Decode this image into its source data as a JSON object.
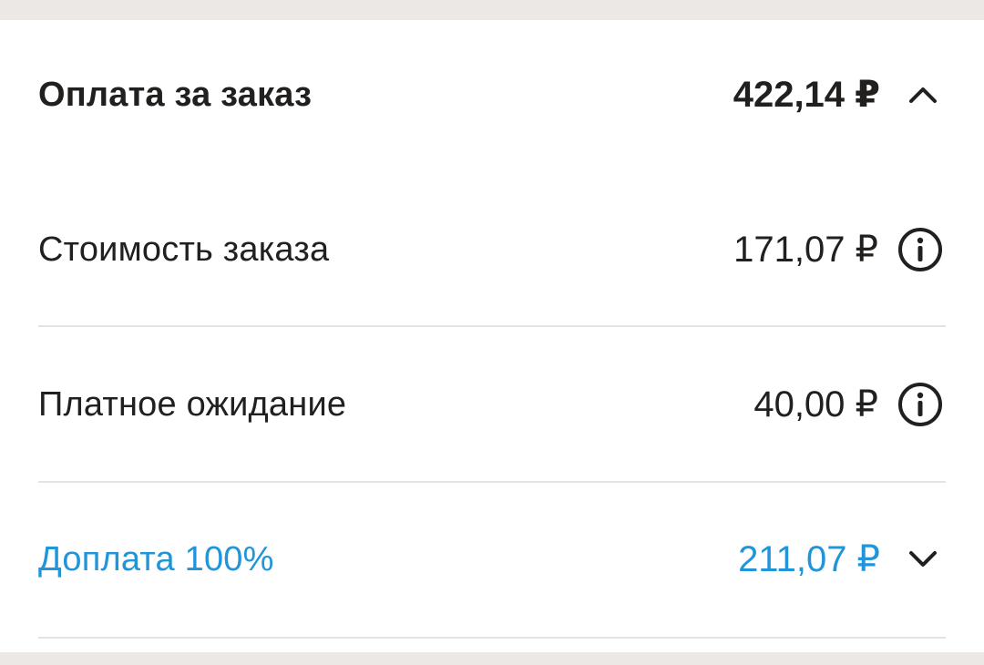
{
  "payment": {
    "title": "Оплата за заказ",
    "total": "422,14 ₽",
    "expand_icon": "chevron-up-icon"
  },
  "lines": [
    {
      "label": "Стоимость заказа",
      "amount": "171,07 ₽",
      "icon": "info-icon"
    },
    {
      "label": "Платное ожидание",
      "amount": "40,00 ₽",
      "icon": "info-icon"
    },
    {
      "label": "Доплата 100%",
      "amount": "211,07 ₽",
      "icon": "chevron-down-icon",
      "color": "#2095d9"
    }
  ],
  "colors": {
    "text": "#21201f",
    "accent": "#2095d9",
    "divider": "#e6e4e1",
    "background": "#ebe8e6"
  }
}
